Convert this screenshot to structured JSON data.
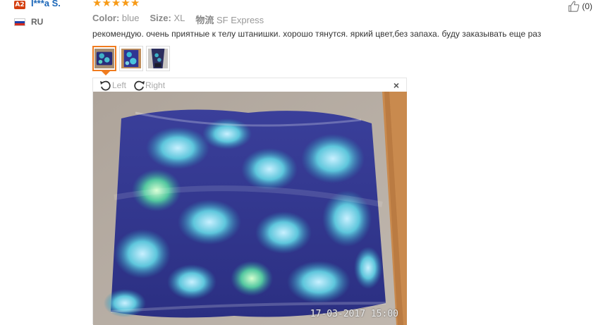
{
  "user": {
    "level_badge": "A2",
    "name": "I***a S.",
    "country": "RU",
    "flag_colors": [
      "#ffffff",
      "#1c3fa8",
      "#d52b1e"
    ]
  },
  "review": {
    "rating": 5,
    "stars": [
      "★",
      "★",
      "★",
      "★",
      "★"
    ],
    "color_label": "Color:",
    "color_value": "blue",
    "size_label": "Size:",
    "size_value": "XL",
    "shipping_label": "物流",
    "shipping_value": "SF Express",
    "text": "рекомендую. очень приятные к телу штанишки. хорошо тянутся. яркий цвет,без запаха. буду заказывать еще раз",
    "helpful_count": "(0)"
  },
  "thumbnails": [
    {
      "name": "photo-1",
      "selected": true
    },
    {
      "name": "photo-2",
      "selected": false
    },
    {
      "name": "photo-3",
      "selected": false
    }
  ],
  "viewer": {
    "rotate_left_label": "Left",
    "rotate_right_label": "Right",
    "close_symbol": "×",
    "timestamp": "17-03-2017 15:00"
  },
  "colors": {
    "accent": "#f07c1f",
    "star": "#f79a16",
    "link": "#1a66b8",
    "badge": "#d43f10"
  }
}
